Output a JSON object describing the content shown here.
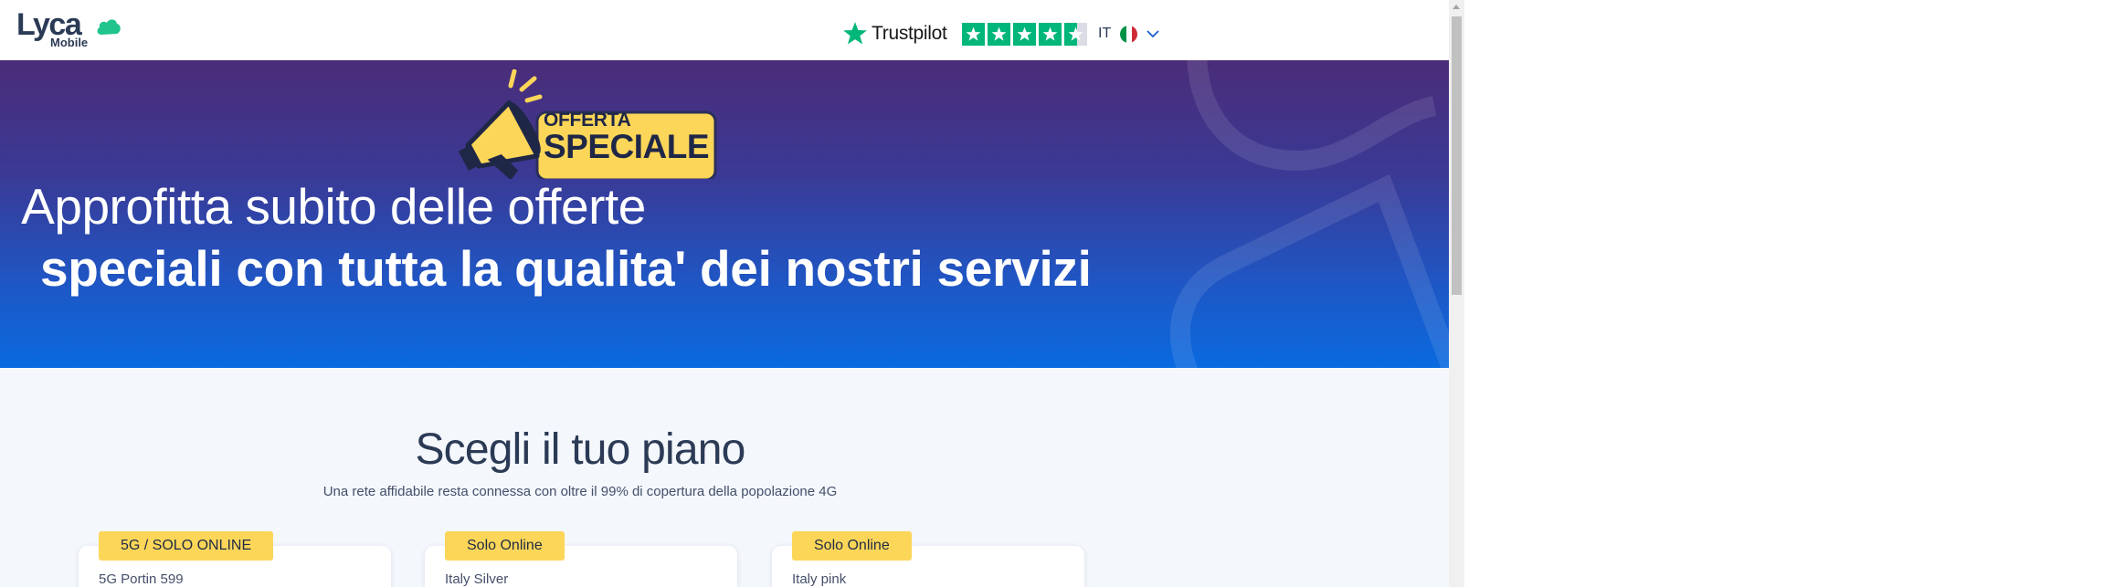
{
  "header": {
    "logo_main": "Lyca",
    "logo_sub": "Mobile",
    "trustpilot_label": "Trustpilot",
    "trustpilot_stars": 4.5,
    "language_code": "IT"
  },
  "hero": {
    "badge_line1": "OFFERTA",
    "badge_line2": "SPECIALE",
    "headline_line1": "Approfitta subito delle offerte",
    "headline_line2": "speciali con tutta la qualita' dei nostri servizi"
  },
  "plans": {
    "title": "Scegli il tuo piano",
    "subtitle": "Una rete affidabile resta connessa con oltre il 99% di copertura della popolazione 4G",
    "cards": [
      {
        "tag": "5G / SOLO ONLINE",
        "name": "5G Portin 599"
      },
      {
        "tag": "Solo Online",
        "name": "Italy Silver"
      },
      {
        "tag": "Solo Online",
        "name": "Italy pink"
      }
    ]
  },
  "colors": {
    "brand_navy": "#2b3a55",
    "brand_green": "#21c48c",
    "trustpilot_green": "#00b67a",
    "tag_yellow": "#fcd658",
    "hero_top": "#4a2c78",
    "hero_bottom": "#0a6ae0"
  }
}
